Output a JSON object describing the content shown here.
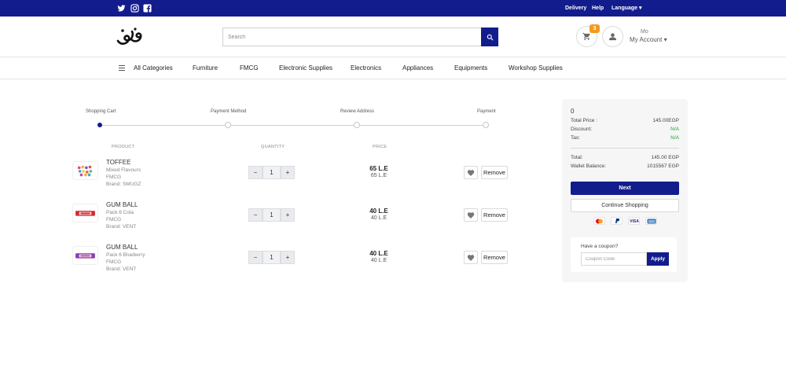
{
  "topbar": {
    "social": [
      "twitter-icon",
      "instagram-icon",
      "facebook-icon"
    ],
    "links": {
      "delivery": "Delivery",
      "help": "Help",
      "language": "Language ▾"
    }
  },
  "header": {
    "search_placeholder": "Search",
    "cart_count": "3",
    "account_greeting": "Mo",
    "account_label": "My Account ▾"
  },
  "nav": {
    "all_categories": "All Categories",
    "items": [
      "Furniture",
      "FMCG",
      "Electronic Supplies",
      "Electronics",
      "Appliances",
      "Equipments",
      "Workshop Supplies"
    ]
  },
  "steps": [
    "Shopping Cart",
    "Payment Method",
    "Review Address",
    "Payment"
  ],
  "columns": {
    "product": "PRODUCT",
    "quantity": "QUANTITY",
    "price": "PRICE"
  },
  "cart": {
    "minus": "−",
    "plus": "+",
    "remove_label": "Remove",
    "items": [
      {
        "name": "TOFFEE",
        "variant": "Mixed Flavours",
        "category": "FMCG",
        "brand": "Brand: SMUGZ",
        "quantity": "1",
        "price": "65 L.E",
        "unit_price": "65 L.E"
      },
      {
        "name": "GUM BALL",
        "variant": "Pack 6 Cola",
        "category": "FMCG",
        "brand": "Brand: VENT",
        "quantity": "1",
        "price": "40 L.E",
        "unit_price": "40 L.E"
      },
      {
        "name": "GUM BALL",
        "variant": "Pack 6 Blueberry",
        "category": "FMCG",
        "brand": "Brand: VENT",
        "quantity": "1",
        "price": "40 L.E",
        "unit_price": "40 L.E"
      }
    ]
  },
  "summary": {
    "count": "0",
    "total_price_label": "Total Price :",
    "total_price": "145.00EGP",
    "discount_label": "Discount:",
    "discount": "N/A",
    "tax_label": "Tax:",
    "tax": "N/A",
    "total_label": "Total:",
    "total": "145.00 EGP",
    "wallet_label": "Wallet Balance:",
    "wallet": "1015567 EGP",
    "next": "Next",
    "continue": "Continue Shopping",
    "payment_icons": [
      "mastercard-icon",
      "paypal-icon",
      "visa-icon",
      "amex-icon"
    ],
    "coupon_label": "Have a coupon?",
    "coupon_placeholder": "Coupon Code",
    "apply": "Apply"
  },
  "colors": {
    "brand": "#131c8c",
    "badge": "#f39a1e",
    "available": "#23a23a"
  }
}
